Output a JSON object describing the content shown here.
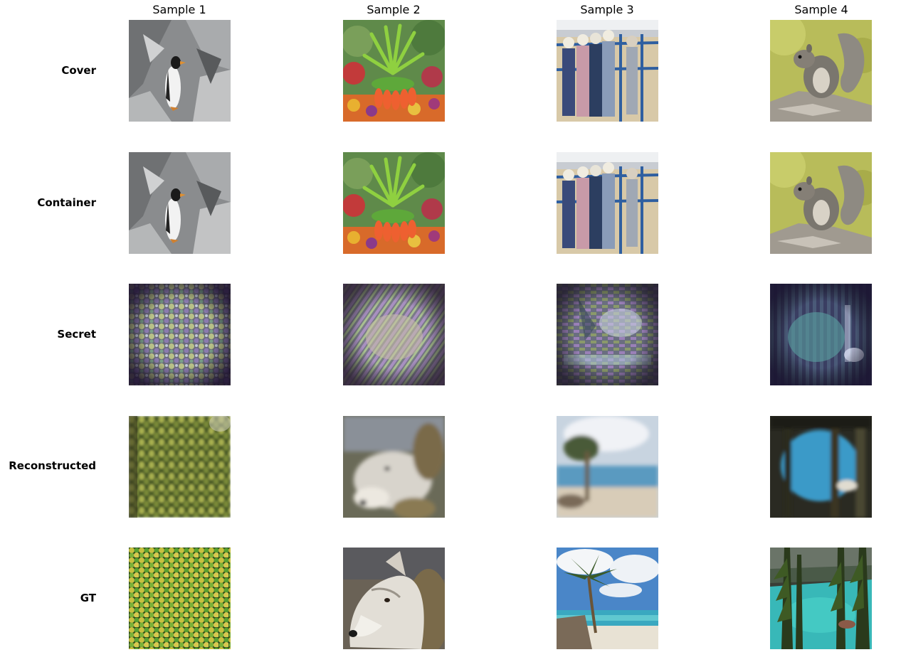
{
  "columns": [
    "Sample 1",
    "Sample 2",
    "Sample 3",
    "Sample 4"
  ],
  "rows": [
    "Cover",
    "Container",
    "Secret",
    "Reconstructed",
    "GT"
  ],
  "images": {
    "cover": [
      "penguin-on-rocks",
      "red-flower-with-green-leaves",
      "cowboys-at-blue-fence",
      "gray-squirrel-on-rock"
    ],
    "container": [
      "penguin-on-rocks",
      "red-flower-with-green-leaves",
      "cowboys-at-blue-fence",
      "gray-squirrel-on-rock"
    ],
    "secret": [
      "noise-residual-pattern",
      "noise-residual-pattern",
      "noise-residual-pattern",
      "noise-residual-pattern"
    ],
    "reconstructed": [
      "blurred-green-yellow-fruit",
      "blurred-white-wolf",
      "blurred-beach-palm-tree",
      "blurred-turquoise-lake-trees"
    ],
    "gt": [
      "green-yellow-fruit",
      "white-wolf",
      "beach-palm-tree",
      "turquoise-lake-trees"
    ]
  }
}
